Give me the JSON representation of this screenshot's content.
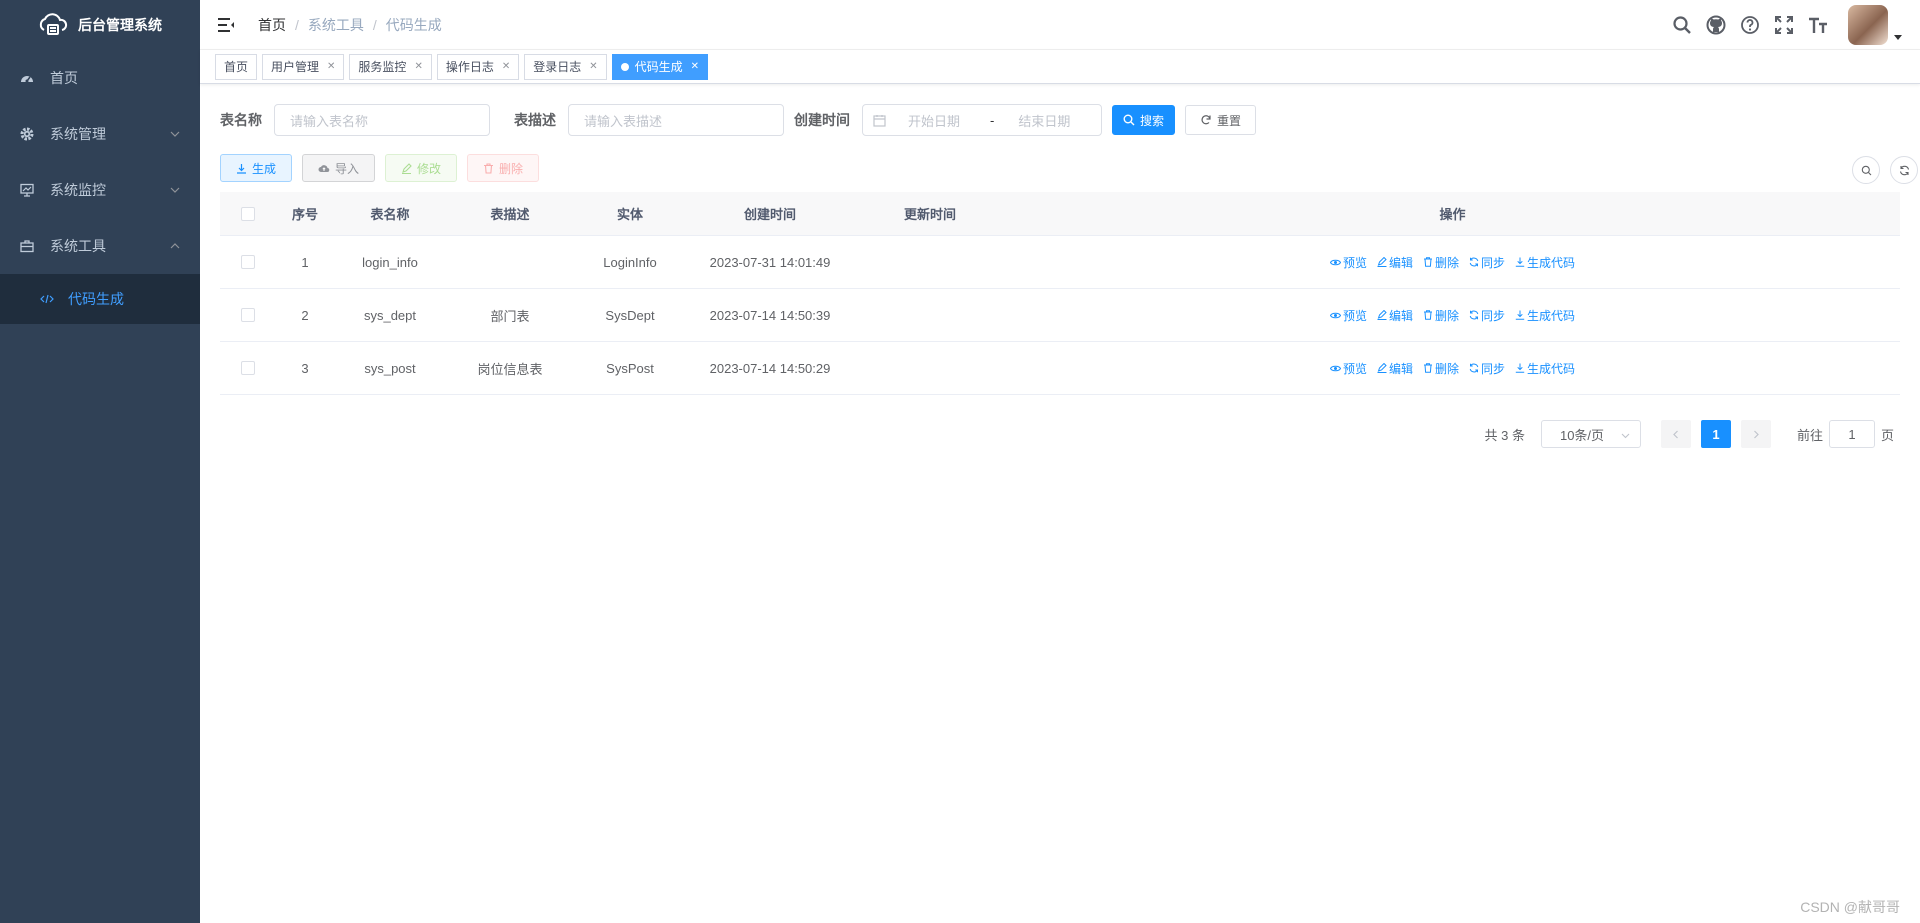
{
  "app": {
    "title": "后台管理系统"
  },
  "sidebar": {
    "items": [
      {
        "label": "首页",
        "icon": "dashboard-icon"
      },
      {
        "label": "系统管理",
        "icon": "gear-icon"
      },
      {
        "label": "系统监控",
        "icon": "monitor-icon"
      },
      {
        "label": "系统工具",
        "icon": "toolbox-icon"
      }
    ],
    "active_sub": {
      "label": "代码生成",
      "icon": "code-icon"
    }
  },
  "breadcrumb": [
    "首页",
    "系统工具",
    "代码生成"
  ],
  "tags": [
    {
      "label": "首页"
    },
    {
      "label": "用户管理"
    },
    {
      "label": "服务监控"
    },
    {
      "label": "操作日志"
    },
    {
      "label": "登录日志"
    },
    {
      "label": "代码生成"
    }
  ],
  "search": {
    "table_name_label": "表名称",
    "table_name_placeholder": "请输入表名称",
    "table_desc_label": "表描述",
    "table_desc_placeholder": "请输入表描述",
    "create_time_label": "创建时间",
    "start_placeholder": "开始日期",
    "range_sep": "-",
    "end_placeholder": "结束日期",
    "search_label": "搜索",
    "reset_label": "重置"
  },
  "toolbar": {
    "generate": "生成",
    "import": "导入",
    "edit": "修改",
    "delete": "删除"
  },
  "table": {
    "headers": {
      "no": "序号",
      "name": "表名称",
      "desc": "表描述",
      "entity": "实体",
      "create_time": "创建时间",
      "update_time": "更新时间",
      "ops": "操作"
    },
    "rows": [
      {
        "no": "1",
        "name": "login_info",
        "desc": "",
        "entity": "LoginInfo",
        "create_time": "2023-07-31 14:01:49",
        "update_time": ""
      },
      {
        "no": "2",
        "name": "sys_dept",
        "desc": "部门表",
        "entity": "SysDept",
        "create_time": "2023-07-14 14:50:39",
        "update_time": ""
      },
      {
        "no": "3",
        "name": "sys_post",
        "desc": "岗位信息表",
        "entity": "SysPost",
        "create_time": "2023-07-14 14:50:29",
        "update_time": ""
      }
    ],
    "ops": {
      "preview": "预览",
      "edit": "编辑",
      "delete": "删除",
      "sync": "同步",
      "gen": "生成代码"
    }
  },
  "pagination": {
    "total": "共 3 条",
    "page_size": "10条/页",
    "current": "1",
    "goto_label": "前往",
    "goto_value": "1",
    "page_suffix": "页"
  },
  "watermark": "CSDN @献哥哥",
  "colors": {
    "sidebar_bg": "#304156",
    "primary": "#1890ff",
    "active_tag": "#409eff"
  }
}
